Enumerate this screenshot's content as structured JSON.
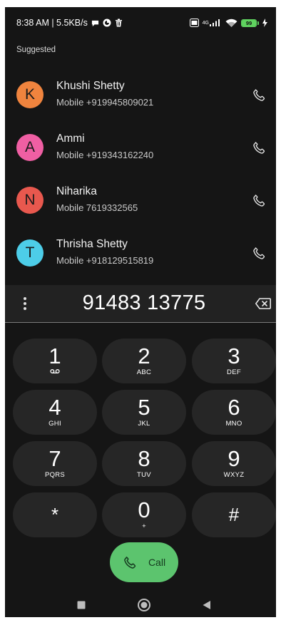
{
  "status_bar": {
    "time_speed": "8:38 AM | 5.5KB/s",
    "network_label_top": "4G",
    "battery_level": "99",
    "battery_fraction": 0.99
  },
  "suggested": {
    "title": "Suggested",
    "contacts": [
      {
        "initial": "K",
        "name": "Khushi Shetty",
        "number": "Mobile +919945809021",
        "color": "#f0843e"
      },
      {
        "initial": "A",
        "name": "Ammi",
        "number": "Mobile +919343162240",
        "color": "#ef5fa3"
      },
      {
        "initial": "N",
        "name": "Niharika",
        "number": "Mobile 7619332565",
        "color": "#e8584e"
      },
      {
        "initial": "T",
        "name": "Thrisha Shetty",
        "number": "Mobile +918129515819",
        "color": "#4dcde8"
      }
    ]
  },
  "dialer": {
    "number": "91483 13775"
  },
  "keypad": [
    {
      "digit": "1",
      "letters": ""
    },
    {
      "digit": "2",
      "letters": "ABC"
    },
    {
      "digit": "3",
      "letters": "DEF"
    },
    {
      "digit": "4",
      "letters": "GHI"
    },
    {
      "digit": "5",
      "letters": "JKL"
    },
    {
      "digit": "6",
      "letters": "MNO"
    },
    {
      "digit": "7",
      "letters": "PQRS"
    },
    {
      "digit": "8",
      "letters": "TUV"
    },
    {
      "digit": "9",
      "letters": "WXYZ"
    },
    {
      "digit": "*",
      "letters": ""
    },
    {
      "digit": "0",
      "letters": "+"
    },
    {
      "digit": "#",
      "letters": ""
    }
  ],
  "call_button": {
    "label": "Call",
    "color": "#5cc46e"
  },
  "icons": {
    "voicemail": "voicemail-icon",
    "phone": "phone-icon",
    "backspace": "backspace-icon",
    "more": "more-vert-icon"
  }
}
